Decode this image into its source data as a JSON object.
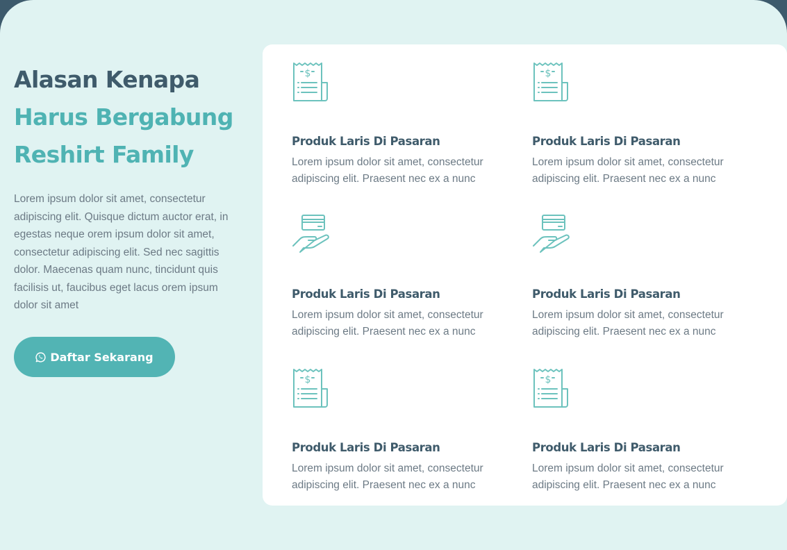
{
  "colors": {
    "heading_dark": "#3f5b6b",
    "heading_accent": "#4fb3b3",
    "button_bg": "#52b4b4",
    "icon_stroke": "#6cc2bd",
    "section_bg": "#e0f3f2",
    "card_bg": "#ffffff"
  },
  "hero": {
    "title_line1": "Alasan Kenapa",
    "title_line2": "Harus Bergabung",
    "title_line3": "Reshirt Family",
    "description": "Lorem ipsum dolor sit amet, consectetur adipiscing elit. Quisque dictum auctor erat, in egestas neque orem ipsum dolor sit amet, consectetur adipiscing elit. Sed nec sagittis dolor. Maecenas quam nunc, tincidunt quis facilisis ut, faucibus eget lacus orem ipsum dolor sit amet",
    "cta_label": "Daftar Sekarang",
    "cta_icon": "whatsapp-icon"
  },
  "features": [
    {
      "icon": "receipt-icon",
      "title": "Produk Laris Di Pasaran",
      "text": "Lorem ipsum dolor sit amet, consectetur adipiscing elit. Praesent nec ex a nunc"
    },
    {
      "icon": "receipt-icon",
      "title": "Produk Laris Di Pasaran",
      "text": "Lorem ipsum dolor sit amet, consectetur adipiscing elit. Praesent nec ex a nunc"
    },
    {
      "icon": "card-payment-icon",
      "title": "Produk Laris Di Pasaran",
      "text": "Lorem ipsum dolor sit amet, consectetur adipiscing elit. Praesent nec ex a nunc"
    },
    {
      "icon": "card-payment-icon",
      "title": "Produk Laris Di Pasaran",
      "text": "Lorem ipsum dolor sit amet, consectetur adipiscing elit. Praesent nec ex a nunc"
    },
    {
      "icon": "receipt-icon",
      "title": "Produk Laris Di Pasaran",
      "text": "Lorem ipsum dolor sit amet, consectetur adipiscing elit. Praesent nec ex a nunc"
    },
    {
      "icon": "receipt-icon",
      "title": "Produk Laris Di Pasaran",
      "text": "Lorem ipsum dolor sit amet, consectetur adipiscing elit. Praesent nec ex a nunc"
    }
  ]
}
